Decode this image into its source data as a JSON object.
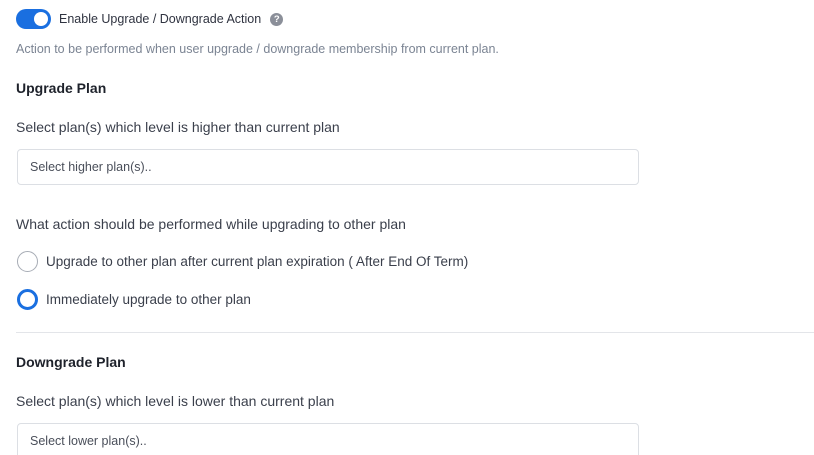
{
  "toggle": {
    "label": "Enable Upgrade / Downgrade Action",
    "enabled": true,
    "help_icon": "question-circle-icon",
    "accent_color": "#1a6fe0"
  },
  "description": "Action to be performed when user upgrade / downgrade membership from current plan.",
  "upgrade": {
    "title": "Upgrade Plan",
    "select_label": "Select plan(s) which level is higher than current plan",
    "select_placeholder": "Select higher plan(s)..",
    "action_question": "What action should be performed while upgrading to other plan",
    "options": [
      {
        "label": "Upgrade to other plan after current plan expiration ( After End Of Term)",
        "selected": false
      },
      {
        "label": "Immediately upgrade to other plan",
        "selected": true
      }
    ]
  },
  "downgrade": {
    "title": "Downgrade Plan",
    "select_label": "Select plan(s) which level is lower than current plan",
    "select_placeholder": "Select lower plan(s).."
  }
}
